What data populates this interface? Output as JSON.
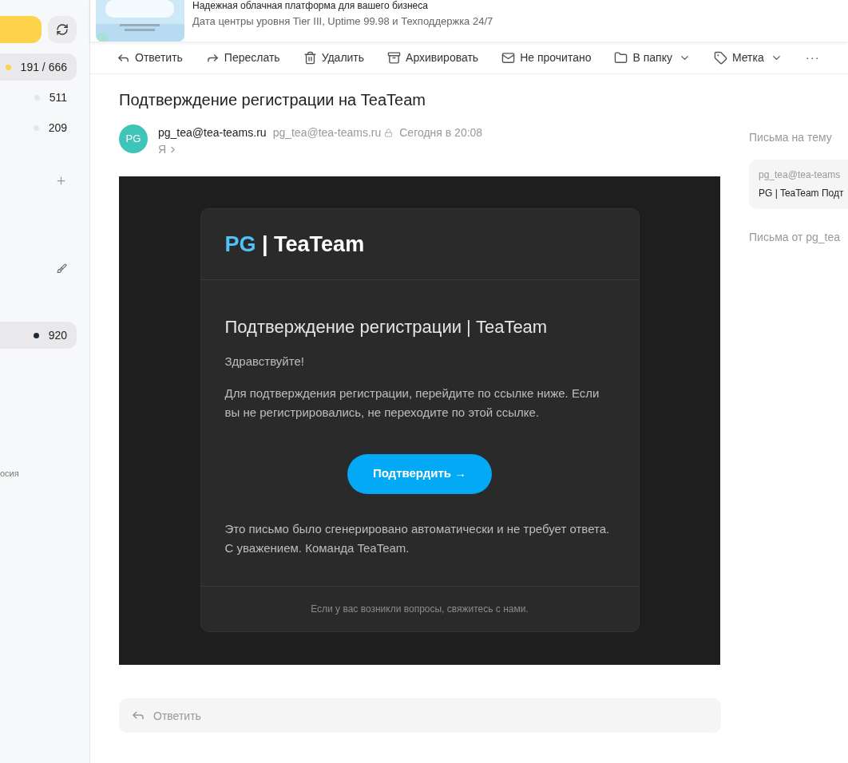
{
  "sidebar": {
    "counters": [
      {
        "text": "191 / 666",
        "color": "#fcd34d",
        "selected": true
      },
      {
        "text": "511",
        "color": "#e5e7eb",
        "selected": false
      },
      {
        "text": "209",
        "color": "#e5e7eb",
        "selected": false
      },
      {
        "text": "920",
        "color": "#1f2937",
        "selected": true
      }
    ],
    "footer": "осия"
  },
  "ad": {
    "title": "Надежная облачная платформа для вашего бизнеса",
    "text": "Дата центры уровня Tier III, Uptime 99.98 и Техподдержка 24/7"
  },
  "toolbar": [
    {
      "kind": "reply",
      "label": "Ответить",
      "dropdown": false
    },
    {
      "kind": "forward",
      "label": "Переслать",
      "dropdown": false
    },
    {
      "kind": "delete",
      "label": "Удалить",
      "dropdown": false
    },
    {
      "kind": "archive",
      "label": "Архивировать",
      "dropdown": false
    },
    {
      "kind": "unread",
      "label": "Не прочитано",
      "dropdown": false
    },
    {
      "kind": "folder",
      "label": "В папку",
      "dropdown": true
    },
    {
      "kind": "tag",
      "label": "Метка",
      "dropdown": true
    },
    {
      "kind": "more",
      "label": "···",
      "dropdown": false
    }
  ],
  "message": {
    "subject": "Подтверждение регистрации на TeaTeam",
    "avatar": "PG",
    "sender_name": "pg_tea@tea-teams.ru",
    "sender_email": "pg_tea@tea-teams.ru",
    "time": "Сегодня в 20:08",
    "recipient": "Я"
  },
  "email_body": {
    "logo_accent": "PG",
    "logo_rest": "| TeaTeam",
    "heading": "Подтверждение регистрации | TeaTeam",
    "greeting": "Здравствуйте!",
    "paragraph": "Для подтверждения регистрации, перейдите по ссылке ниже. Если вы не регистрировались, не переходите по этой ссылке.",
    "button": "Подтвердить →",
    "closing": [
      "Это письмо было сгенерировано автоматически и не требует ответа.",
      "С уважением. Команда TeaTeam."
    ],
    "footer": "Если у вас возникли вопросы, свяжитесь с нами."
  },
  "reply_box": {
    "placeholder": "Ответить"
  },
  "thread_pane": {
    "title": "Письма на тему",
    "thread": {
      "from": "pg_tea@tea-teams",
      "subject": "PG | TeaTeam Подт"
    },
    "from_title": "Письма от pg_tea"
  }
}
